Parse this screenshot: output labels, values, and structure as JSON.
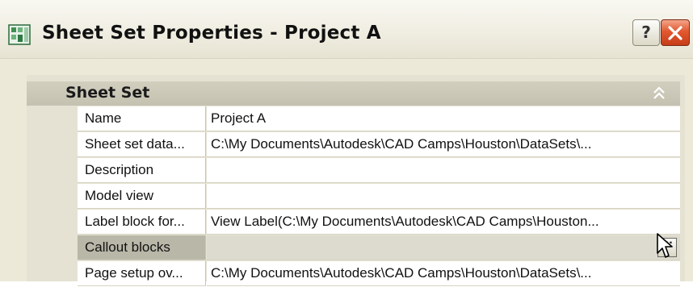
{
  "window": {
    "title": "Sheet Set Properties - Project A",
    "help_label": "?"
  },
  "group": {
    "title": "Sheet Set"
  },
  "properties": [
    {
      "label": "Name",
      "value": "Project A"
    },
    {
      "label": "Sheet set data...",
      "value": "C:\\My Documents\\Autodesk\\CAD Camps\\Houston\\DataSets\\..."
    },
    {
      "label": "Description",
      "value": ""
    },
    {
      "label": "Model view",
      "value": ""
    },
    {
      "label": "Label block for...",
      "value": "View Label(C:\\My Documents\\Autodesk\\CAD Camps\\Houston..."
    },
    {
      "label": "Callout blocks",
      "value": "",
      "selected": true
    },
    {
      "label": "Page setup ov...",
      "value": "C:\\My Documents\\Autodesk\\CAD Camps\\Houston\\DataSets\\..."
    }
  ],
  "ellipsis_label": "...",
  "icons": {
    "app": "sheet-set-app-icon",
    "help": "help-icon",
    "close": "close-icon",
    "collapse": "double-chevron-up-icon",
    "cursor": "mouse-pointer-icon"
  },
  "colors": {
    "close_button": "#d94a22",
    "selected_row": "#b9b7a8"
  }
}
